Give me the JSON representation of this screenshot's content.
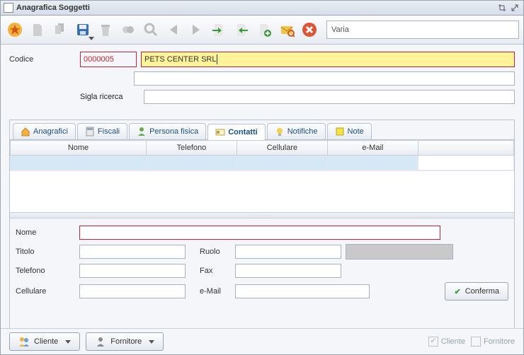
{
  "window": {
    "title": "Anagrafica Soggetti"
  },
  "toolbar": {
    "mode": "Varia"
  },
  "header": {
    "codice_label": "Codice",
    "codice_value": "0000005",
    "name_value": "PETS CENTER SRL",
    "sigla_label": "Sigla ricerca"
  },
  "tabs": [
    {
      "label": "Anagrafici"
    },
    {
      "label": "Fiscali"
    },
    {
      "label": "Persona fisica"
    },
    {
      "label": "Contatti"
    },
    {
      "label": "Notifiche"
    },
    {
      "label": "Note"
    }
  ],
  "grid": {
    "columns": [
      "Nome",
      "Telefono",
      "Cellulare",
      "e-Mail"
    ]
  },
  "form": {
    "nome_label": "Nome",
    "titolo_label": "Titolo",
    "ruolo_label": "Ruolo",
    "telefono_label": "Telefono",
    "fax_label": "Fax",
    "cellulare_label": "Cellulare",
    "email_label": "e-Mail",
    "conferma_label": "Conferma"
  },
  "footer": {
    "cliente_label": "Cliente",
    "fornitore_label": "Fornitore",
    "chk_cliente": "Cliente",
    "chk_fornitore": "Fornitore"
  }
}
